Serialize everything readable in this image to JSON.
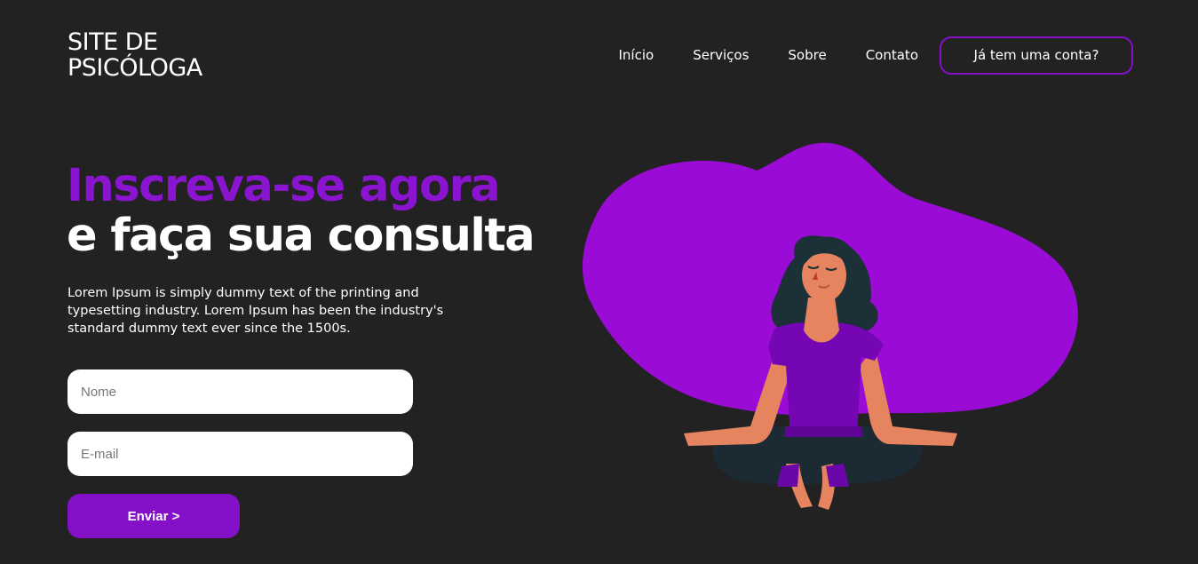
{
  "header": {
    "logo_line1": "SITE DE",
    "logo_line2": "PSICÓLOGA",
    "nav": [
      {
        "label": "Início"
      },
      {
        "label": "Serviços"
      },
      {
        "label": "Sobre"
      },
      {
        "label": "Contato"
      }
    ],
    "account_button": "Já tem uma conta?"
  },
  "hero": {
    "title_accent": "Inscreva-se agora",
    "title_main": "e faça sua consulta",
    "description": "Lorem Ipsum is simply dummy text of the printing and typesetting industry. Lorem Ipsum has been the industry's standard dummy text ever since the 1500s."
  },
  "form": {
    "name_placeholder": "Nome",
    "email_placeholder": "E-mail",
    "submit_label": "Enviar >"
  },
  "colors": {
    "background": "#222222",
    "accent": "#8410c8",
    "blob": "#9a0bd6",
    "text": "#ffffff"
  },
  "illustration": {
    "icon": "meditating-woman-illustration"
  }
}
